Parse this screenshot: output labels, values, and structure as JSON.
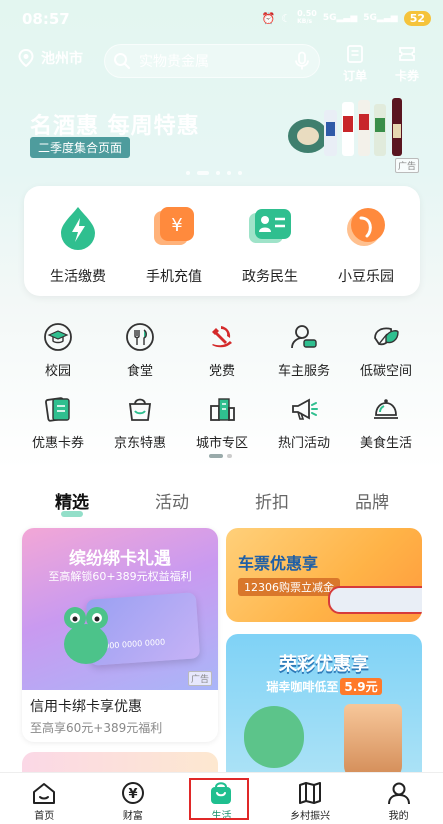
{
  "status_bar": {
    "time": "08:57",
    "network_speed": "0.50",
    "network_unit": "KB/s",
    "signal1": "5G",
    "signal2": "5G",
    "battery": "52"
  },
  "header": {
    "location": "池州市",
    "search_placeholder": "实物贵金属",
    "orders_label": "订单",
    "coupons_label": "卡券"
  },
  "banner": {
    "title": "名酒惠 每周特惠",
    "subtitle": "二季度集合页面",
    "ad_tag": "广告",
    "slides": 5,
    "active_slide": 2
  },
  "quick_services": [
    {
      "label": "生活缴费",
      "icon": "bill-payment-icon",
      "color": "#2fbf8f"
    },
    {
      "label": "手机充值",
      "icon": "mobile-topup-icon",
      "color": "#ff8a3d"
    },
    {
      "label": "政务民生",
      "icon": "id-card-icon",
      "color": "#2fbf8f"
    },
    {
      "label": "小豆乐园",
      "icon": "bean-icon",
      "color": "#ff8a3d"
    }
  ],
  "grid": [
    [
      {
        "label": "校园",
        "icon": "graduation-cap-icon"
      },
      {
        "label": "食堂",
        "icon": "utensils-icon"
      },
      {
        "label": "党费",
        "icon": "party-emblem-icon"
      },
      {
        "label": "车主服务",
        "icon": "car-owner-icon"
      },
      {
        "label": "低碳空间",
        "icon": "leaf-icon"
      }
    ],
    [
      {
        "label": "优惠卡券",
        "icon": "coupon-icon"
      },
      {
        "label": "京东特惠",
        "icon": "shopping-bag-icon"
      },
      {
        "label": "城市专区",
        "icon": "city-buildings-icon"
      },
      {
        "label": "热门活动",
        "icon": "megaphone-icon"
      },
      {
        "label": "美食生活",
        "icon": "food-cloche-icon"
      }
    ]
  ],
  "tabs": [
    {
      "label": "精选",
      "active": true
    },
    {
      "label": "活动",
      "active": false
    },
    {
      "label": "折扣",
      "active": false
    },
    {
      "label": "品牌",
      "active": false
    }
  ],
  "feed": {
    "card1": {
      "banner_title": "缤纷绑卡礼遇",
      "banner_subtitle": "至高解锁60+389元权益福利",
      "card_number": "0000 0000 0000",
      "ad_tag": "广告",
      "title": "信用卡绑卡享优惠",
      "subtitle": "至高享60元+389元福利"
    },
    "card2": {
      "title": "车票优惠享",
      "subtitle": "12306购票立减金"
    },
    "card3": {
      "title": "荣彩优惠享",
      "subtitle": "瑞幸咖啡低至",
      "price": "5.9元"
    }
  },
  "bottom_nav": [
    {
      "label": "首页",
      "icon": "home-icon",
      "active": false
    },
    {
      "label": "财富",
      "icon": "wealth-yen-icon",
      "active": false
    },
    {
      "label": "生活",
      "icon": "life-bag-icon",
      "active": true
    },
    {
      "label": "乡村振兴",
      "icon": "book-map-icon",
      "active": false
    },
    {
      "label": "我的",
      "icon": "user-icon",
      "active": false
    }
  ]
}
